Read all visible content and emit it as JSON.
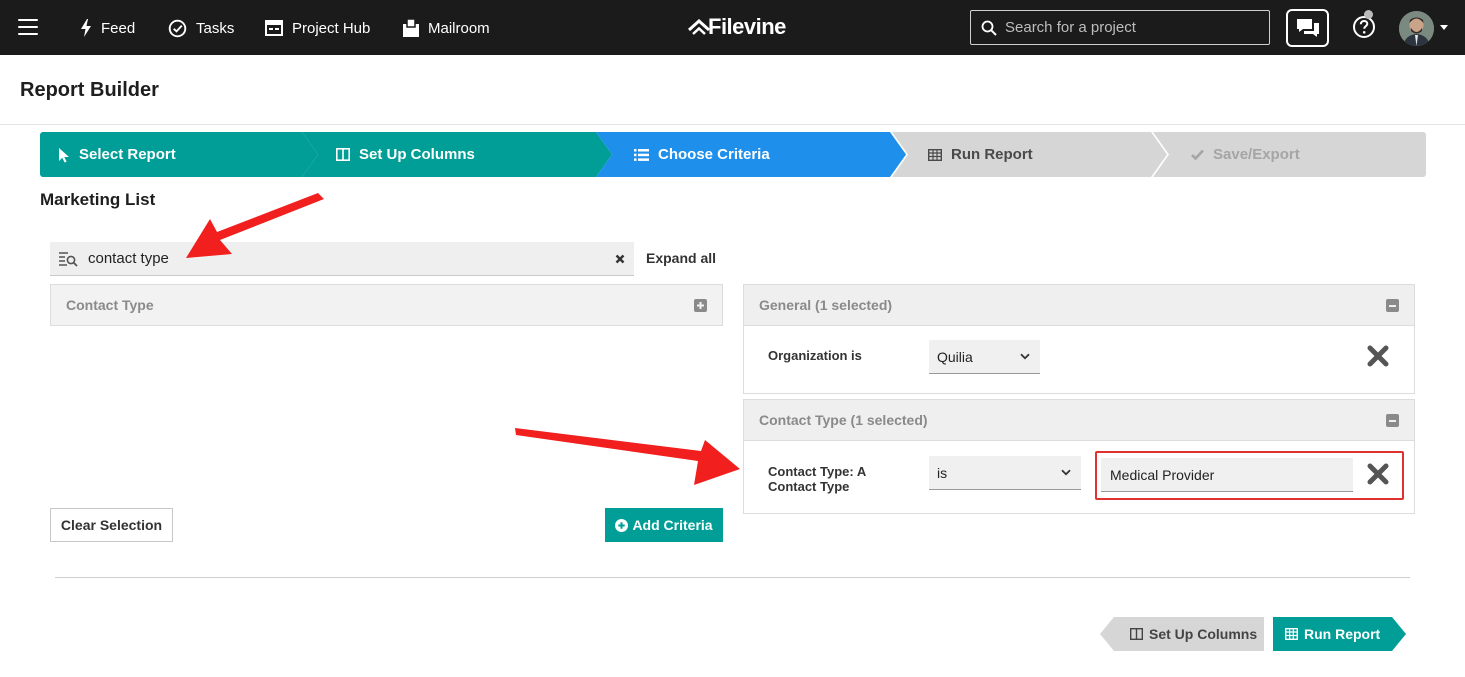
{
  "nav": {
    "feed": "Feed",
    "tasks": "Tasks",
    "project_hub": "Project Hub",
    "mailroom": "Mailroom",
    "brand": "Filevine",
    "search_placeholder": "Search for a project"
  },
  "page": {
    "title": "Report Builder",
    "report_name": "Marketing List"
  },
  "steps": [
    {
      "label": "Select Report",
      "state": "complete"
    },
    {
      "label": "Set Up Columns",
      "state": "complete"
    },
    {
      "label": "Choose Criteria",
      "state": "active"
    },
    {
      "label": "Run Report",
      "state": "upcoming"
    },
    {
      "label": "Save/Export",
      "state": "disabled"
    }
  ],
  "left": {
    "filter_value": "contact type",
    "expand_all": "Expand all",
    "field_group": "Contact Type",
    "clear_selection": "Clear Selection",
    "add_criteria": "Add Criteria"
  },
  "criteria": [
    {
      "group": "General (1 selected)",
      "label": "Organization is",
      "operator": "Quilia"
    },
    {
      "group": "Contact Type (1 selected)",
      "label": "Contact Type: A Contact Type",
      "operator": "is",
      "value": "Medical Provider"
    }
  ],
  "footer": {
    "back": "Set Up Columns",
    "next": "Run Report"
  },
  "colors": {
    "teal": "#009e96",
    "active_blue": "#1e90ec",
    "nav_bg": "#1b1b1b",
    "annotation_red": "#f21f1f"
  }
}
